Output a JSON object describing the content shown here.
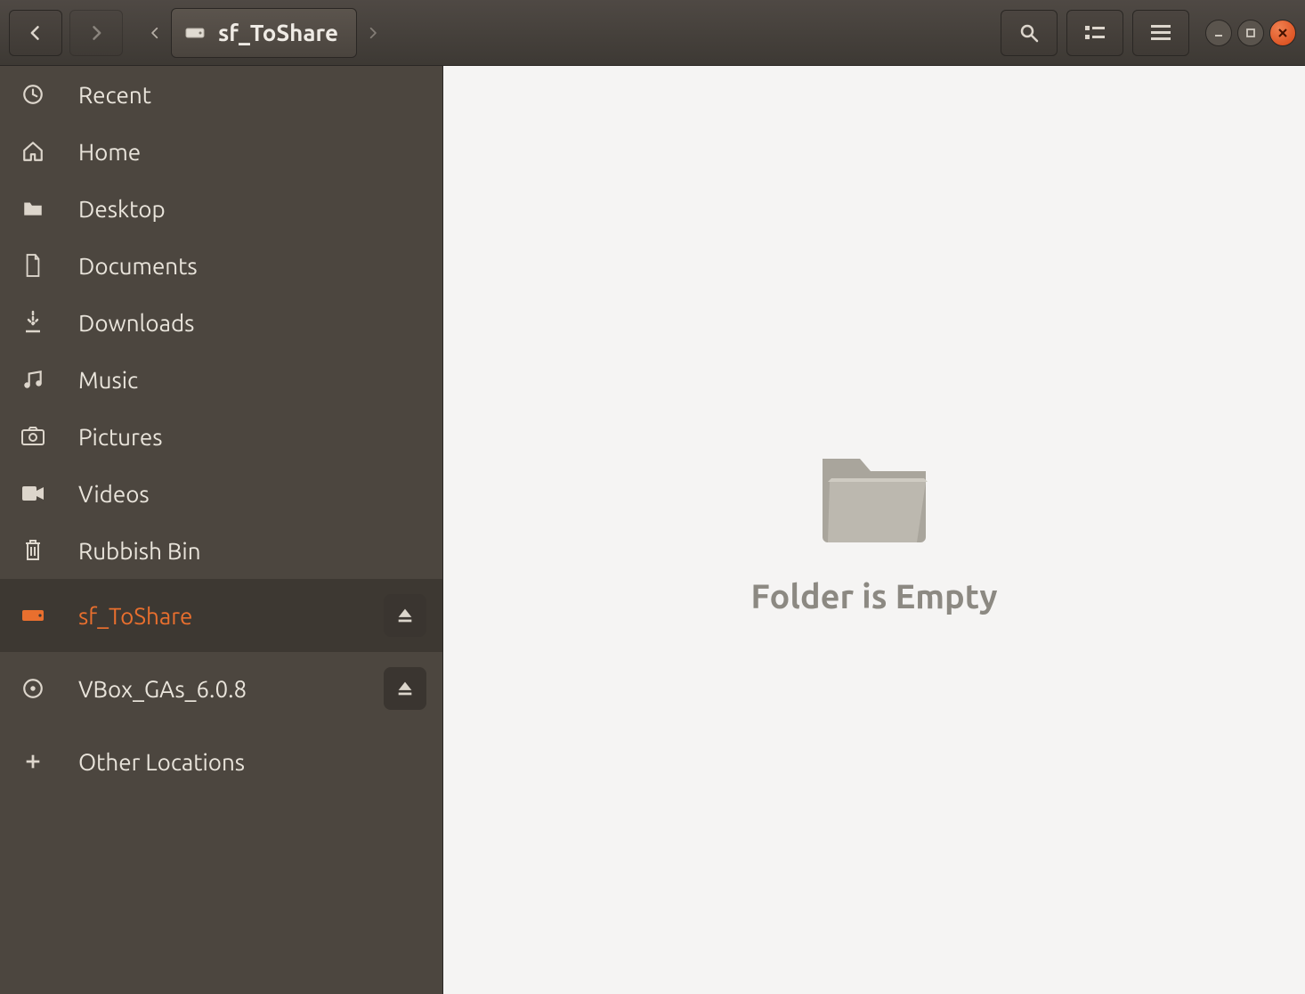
{
  "path": {
    "current_label": "sf_ToShare"
  },
  "sidebar": {
    "items": [
      {
        "label": "Recent"
      },
      {
        "label": "Home"
      },
      {
        "label": "Desktop"
      },
      {
        "label": "Documents"
      },
      {
        "label": "Downloads"
      },
      {
        "label": "Music"
      },
      {
        "label": "Pictures"
      },
      {
        "label": "Videos"
      },
      {
        "label": "Rubbish Bin"
      },
      {
        "label": "sf_ToShare"
      },
      {
        "label": "VBox_GAs_6.0.8"
      },
      {
        "label": "Other Locations"
      }
    ]
  },
  "content": {
    "empty_message": "Folder is Empty"
  }
}
